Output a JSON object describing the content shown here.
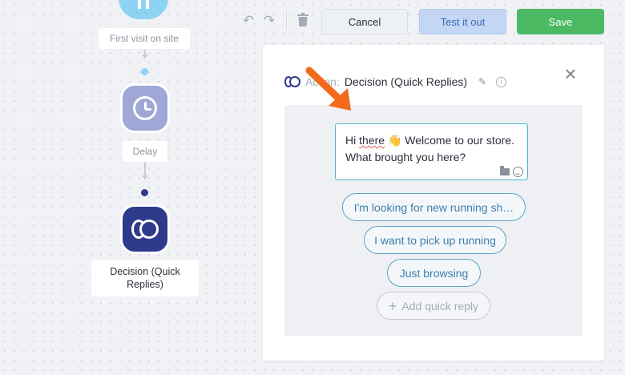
{
  "canvas": {
    "nodes": {
      "first_visit_label": "First visit on site",
      "delay_label": "Delay",
      "decision_label": "Decision (Quick Replies)"
    },
    "node_icons": {
      "trigger": "pause-icon",
      "delay": "clock-icon",
      "decision": "quick-replies-icon"
    },
    "colors": {
      "trigger": "#8ed3f4",
      "delay": "#9ea7d6",
      "decision": "#2e3a8c",
      "connector_dot_light": "#8ed3f4",
      "connector_dot_dark": "#2e3a8c"
    }
  },
  "toolbar": {
    "undo_icon": "↶",
    "redo_icon": "↷",
    "trash_icon": "🗑",
    "cancel_label": "Cancel",
    "test_label": "Test it out",
    "save_label": "Save",
    "colors": {
      "save": "#4cb963",
      "test": "#c3d7f5"
    }
  },
  "panel": {
    "action_prefix": "Action:",
    "action_name": "Decision (Quick Replies)",
    "edit_icon": "✎",
    "info_icon": "i",
    "close_icon": "×",
    "message": {
      "greeting": "Hi",
      "misspelled_word": "there",
      "wave_emoji": "👋",
      "rest": "Welcome to our store. What brought you here?"
    },
    "quick_replies": [
      {
        "label": "I'm looking for new running sh…"
      },
      {
        "label": "I want to pick up running"
      },
      {
        "label": "Just browsing"
      }
    ],
    "add_reply_label": "Add quick reply",
    "add_reply_icon": "+"
  },
  "annotation": {
    "arrow_color": "#f26a1b",
    "arrow_icon": "arrow-down-right-icon"
  }
}
